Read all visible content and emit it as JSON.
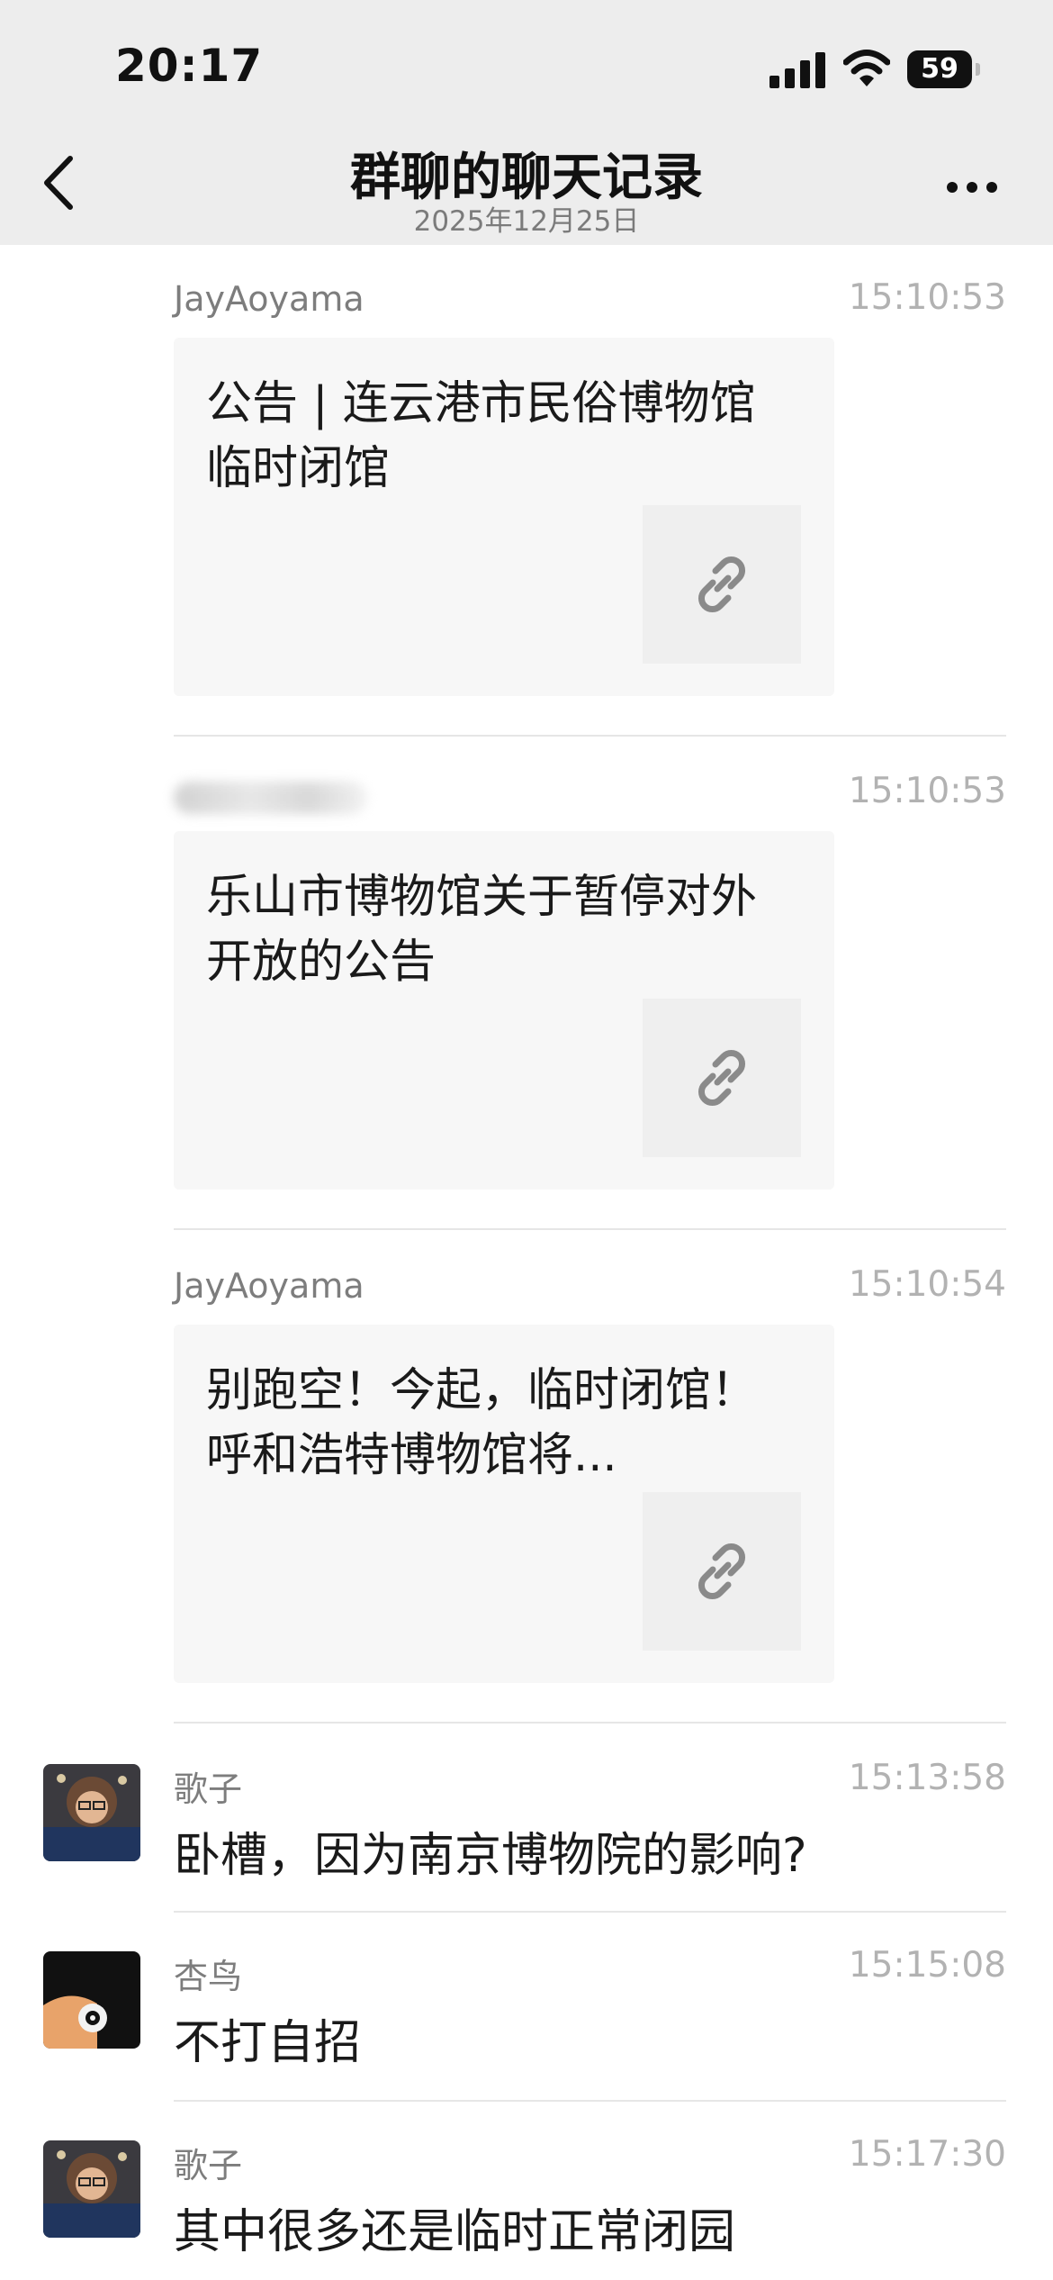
{
  "status_bar": {
    "time": "20:17",
    "battery": "59"
  },
  "header": {
    "title": "群聊的聊天记录",
    "subtitle": "2025年12月25日"
  },
  "messages": [
    {
      "sender": "JayAoyama",
      "time": "15:10:53",
      "card_title": "公告 | 连云港市民俗博物馆临时闭馆"
    },
    {
      "sender": "",
      "time": "15:10:53",
      "card_title": "乐山市博物馆关于暂停对外开放的公告"
    },
    {
      "sender": "JayAoyama",
      "time": "15:10:54",
      "card_title": "别跑空！今起，临时闭馆！呼和浩特博物馆将..."
    },
    {
      "sender": "歌子",
      "time": "15:13:58",
      "text": "卧槽，因为南京博物院的影响?"
    },
    {
      "sender": "杏鸟",
      "time": "15:15:08",
      "text": "不打自招"
    },
    {
      "sender": "歌子",
      "time": "15:17:30",
      "text": "其中很多还是临时正常闭园"
    }
  ],
  "colors": {
    "header_bg": "#ededed",
    "card_bg": "#f7f7f7",
    "sender_gray": "#7d7d7d",
    "time_gray": "#b2b2b2"
  },
  "icons": [
    "back-chevron-icon",
    "more-dots-icon",
    "link-icon",
    "signal-icon",
    "wifi-icon",
    "battery-icon"
  ]
}
